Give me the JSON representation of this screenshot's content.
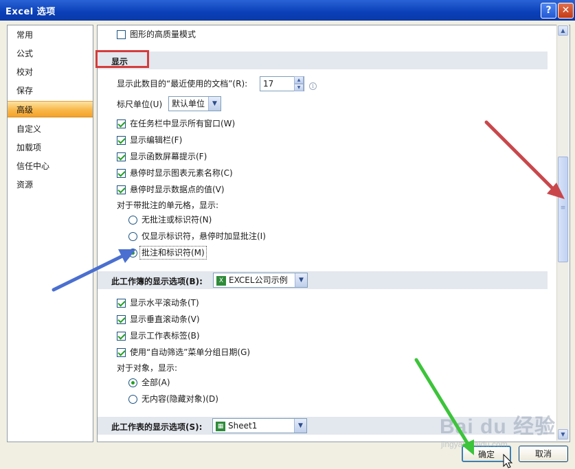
{
  "window": {
    "title": "Excel 选项",
    "help_glyph": "?",
    "close_glyph": "✕"
  },
  "sidebar": {
    "items": [
      {
        "label": "常用",
        "selected": false
      },
      {
        "label": "公式",
        "selected": false
      },
      {
        "label": "校对",
        "selected": false
      },
      {
        "label": "保存",
        "selected": false
      },
      {
        "label": "高级",
        "selected": true
      },
      {
        "label": "自定义",
        "selected": false
      },
      {
        "label": "加载项",
        "selected": false
      },
      {
        "label": "信任中心",
        "selected": false
      },
      {
        "label": "资源",
        "selected": false
      }
    ]
  },
  "top_option": {
    "label": "图形的高质量模式",
    "checked": false
  },
  "display": {
    "header": "显示",
    "recent_docs_label": "显示此数目的“最近使用的文档”(R):",
    "recent_docs_value": "17",
    "ruler_label": "标尺单位(U)",
    "ruler_value": "默认单位",
    "checks": [
      {
        "label": "在任务栏中显示所有窗口(W)",
        "checked": true
      },
      {
        "label": "显示编辑栏(F)",
        "checked": true
      },
      {
        "label": "显示函数屏幕提示(F)",
        "checked": true
      },
      {
        "label": "悬停时显示图表元素名称(C)",
        "checked": true
      },
      {
        "label": "悬停时显示数据点的值(V)",
        "checked": true
      }
    ],
    "comment_heading": "对于带批注的单元格，显示:",
    "comment_options": [
      {
        "label": "无批注或标识符(N)",
        "selected": false
      },
      {
        "label": "仅显示标识符，悬停时加显批注(I)",
        "selected": false
      },
      {
        "label": "批注和标识符(M)",
        "selected": true
      }
    ]
  },
  "workbook": {
    "header": "此工作簿的显示选项(B):",
    "workbook_value": "EXCEL公司示例",
    "checks": [
      {
        "label": "显示水平滚动条(T)",
        "checked": true
      },
      {
        "label": "显示垂直滚动条(V)",
        "checked": true
      },
      {
        "label": "显示工作表标签(B)",
        "checked": true
      },
      {
        "label": "使用“自动筛选”菜单分组日期(G)",
        "checked": true
      }
    ],
    "objects_heading": "对于对象，显示:",
    "object_options": [
      {
        "label": "全部(A)",
        "selected": true
      },
      {
        "label": "无内容(隐藏对象)(D)",
        "selected": false
      }
    ]
  },
  "worksheet": {
    "header": "此工作表的显示选项(S):",
    "sheet_value": "Sheet1"
  },
  "buttons": {
    "ok": "确定",
    "cancel": "取消"
  },
  "watermark": {
    "text": "Bai du 经验",
    "url": "jingyan.baidu.com"
  },
  "colors": {
    "selected_nav": "#f8b74a",
    "highlight_box": "#d43c3c",
    "arrow_red": "#c9474b",
    "arrow_blue": "#4a6fd0",
    "arrow_green": "#3cc43a"
  }
}
